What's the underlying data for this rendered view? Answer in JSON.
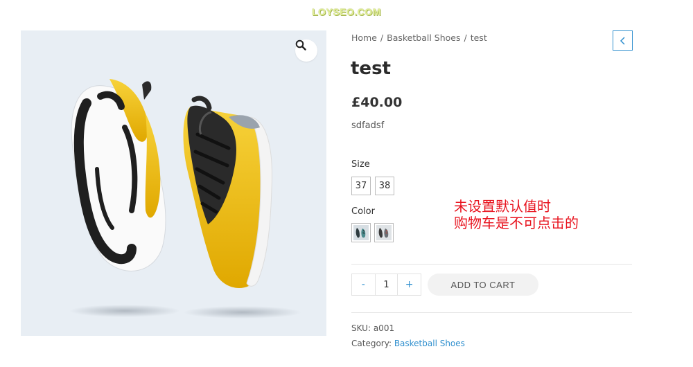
{
  "watermark": "LOYSEO.COM",
  "breadcrumb": {
    "items": [
      "Home",
      "Basketball Shoes",
      "test"
    ],
    "separator": "/"
  },
  "product": {
    "title": "test",
    "price": "£40.00",
    "description": "sdfadsf"
  },
  "attributes": {
    "size_label": "Size",
    "sizes": [
      "37",
      "38"
    ],
    "color_label": "Color",
    "colors": [
      "shoe-swatch-teal",
      "shoe-swatch-dark"
    ]
  },
  "cart": {
    "minus": "-",
    "quantity": "1",
    "plus": "+",
    "add_to_cart": "ADD TO CART"
  },
  "meta": {
    "sku_label": "SKU:",
    "sku": "a001",
    "category_label": "Category:",
    "category": "Basketball Shoes"
  },
  "annotation": {
    "line1": "未设置默认值时",
    "line2": "购物车是不可点击的"
  },
  "icons": {
    "zoom": "magnifier-icon",
    "back": "chevron-left-icon"
  },
  "colors": {
    "link": "#2f8fce",
    "annotation": "#e8141f",
    "shoe_yellow": "#f5c21a",
    "image_bg": "#e8eef4"
  }
}
